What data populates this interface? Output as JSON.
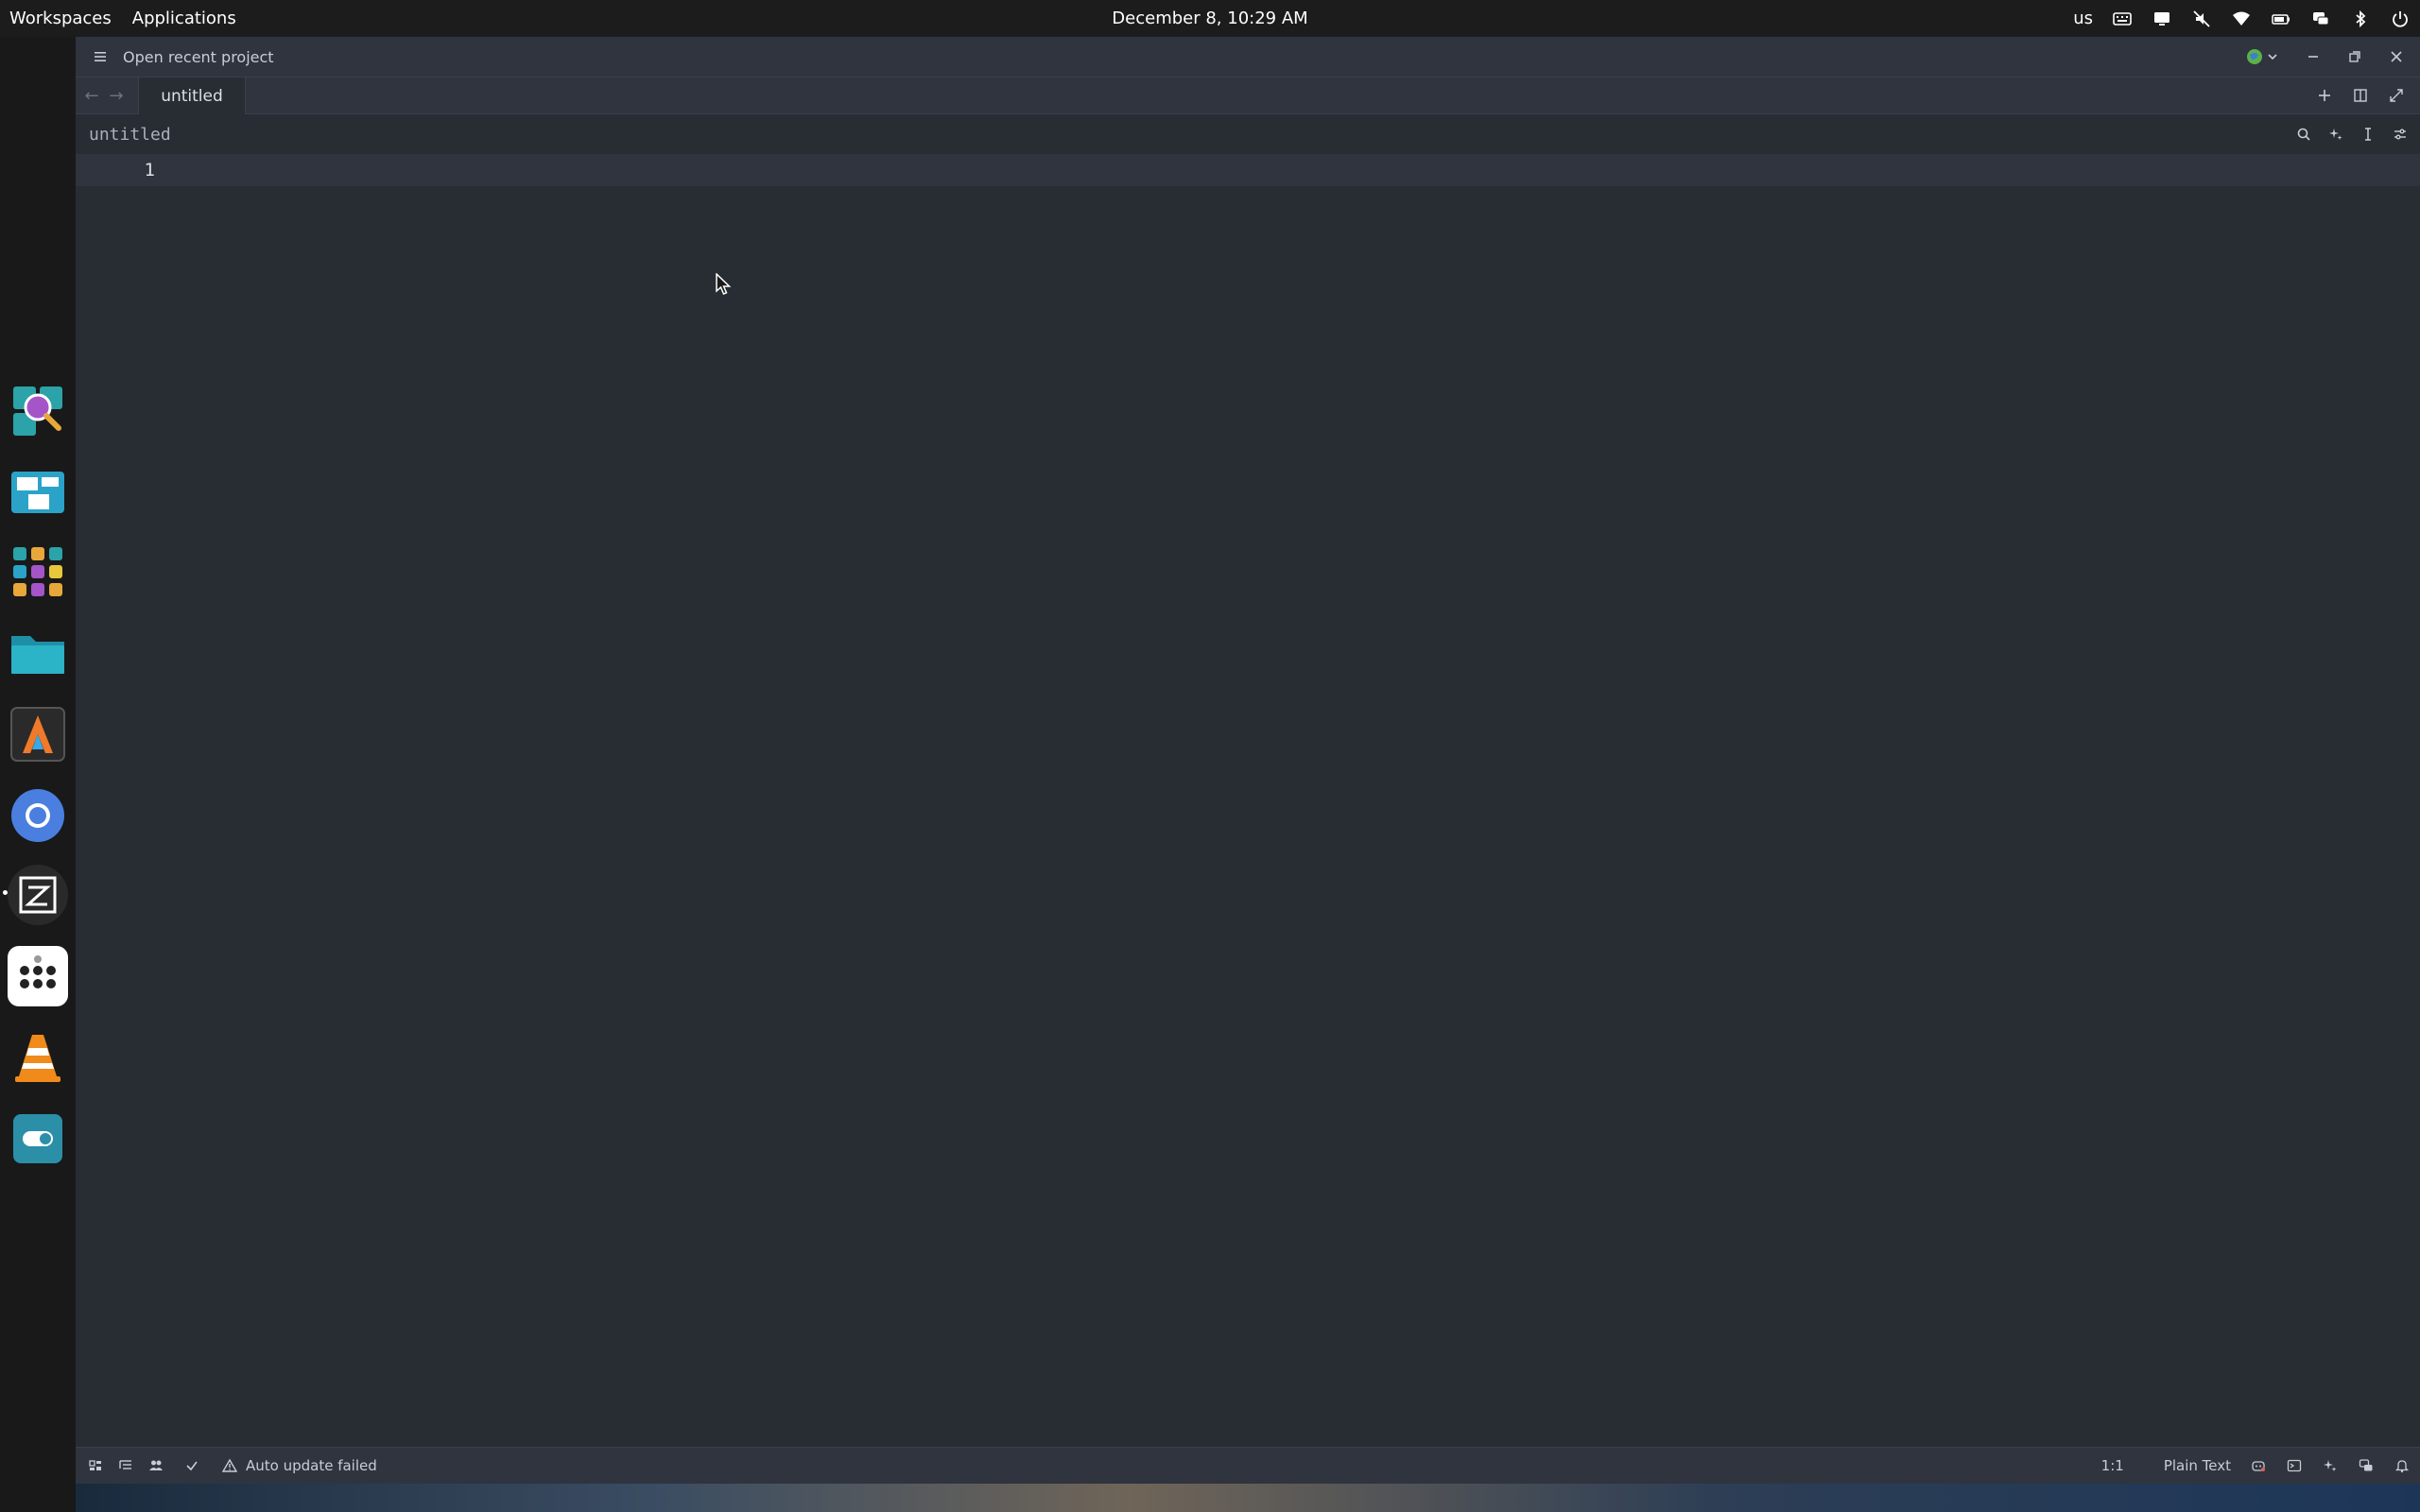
{
  "topbar": {
    "workspaces": "Workspaces",
    "applications": "Applications",
    "clock": "December 8, 10:29 AM",
    "keyboard_layout": "us",
    "tray_icons": [
      "keyboard-icon",
      "screen-icon",
      "mute-icon",
      "wifi-icon",
      "battery-icon",
      "chat-icon",
      "bluetooth-icon",
      "power-icon"
    ]
  },
  "dock": {
    "apps": [
      "search-app-icon",
      "workspaces-app-icon",
      "app-grid-icon",
      "files-icon",
      "alacritty-icon",
      "chromium-icon",
      "zed-icon",
      "dots-app-icon",
      "vlc-icon",
      "settings-toggle-icon"
    ]
  },
  "editor": {
    "titlebar": {
      "open_recent": "Open recent project"
    },
    "tab": {
      "label": "untitled"
    },
    "breadcrumb": "untitled",
    "lines": [
      "1"
    ]
  },
  "statusbar": {
    "warning": "Auto update failed",
    "position": "1:1",
    "language": "Plain Text"
  },
  "colors": {
    "editor_bg": "#282c33",
    "panel_bg": "#2f343e",
    "text": "#c8ccd4"
  }
}
